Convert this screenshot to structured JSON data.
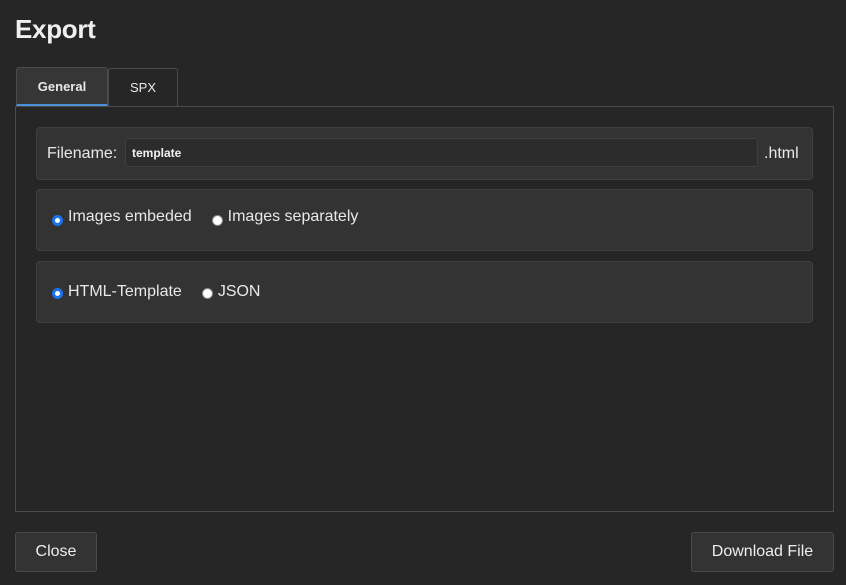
{
  "dialog": {
    "title": "Export"
  },
  "tabs": [
    {
      "label": "General",
      "active": true
    },
    {
      "label": "SPX",
      "active": false
    }
  ],
  "filename": {
    "label": "Filename:",
    "value": "template",
    "extension": ".html"
  },
  "images_option": {
    "options": [
      {
        "label": "Images embeded",
        "selected": true
      },
      {
        "label": "Images separately",
        "selected": false
      }
    ]
  },
  "format_option": {
    "options": [
      {
        "label": "HTML-Template",
        "selected": true
      },
      {
        "label": "JSON",
        "selected": false
      }
    ]
  },
  "buttons": {
    "close_label": "Close",
    "download_label": "Download File"
  },
  "colors": {
    "background": "#262626",
    "panel": "#333333",
    "accent": "#1a73e8",
    "active_tab_underline": "#4a90d9"
  }
}
